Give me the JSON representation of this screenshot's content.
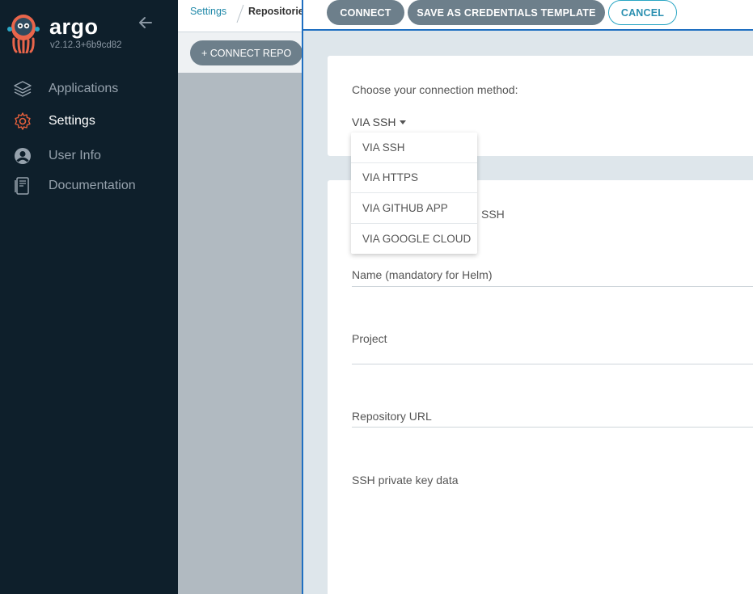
{
  "sidebar": {
    "brand": "argo",
    "version": "v2.12.3+6b9cd82",
    "items": [
      {
        "label": "Applications",
        "icon": "layers-icon"
      },
      {
        "label": "Settings",
        "icon": "gear-icon"
      },
      {
        "label": "User Info",
        "icon": "user-icon"
      },
      {
        "label": "Documentation",
        "icon": "book-icon"
      }
    ]
  },
  "breadcrumb": {
    "parent": "Settings",
    "current": "Repositories"
  },
  "toolbar": {
    "connect_repo": "+ CONNECT REPO"
  },
  "panel": {
    "actions": {
      "connect": "CONNECT",
      "save_template": "SAVE AS CREDENTIALS TEMPLATE",
      "cancel": "CANCEL"
    },
    "method_label": "Choose your connection method:",
    "method_selected": "VIA SSH",
    "dropdown_options": [
      "VIA SSH",
      "VIA HTTPS",
      "VIA GITHUB APP",
      "VIA GOOGLE CLOUD"
    ],
    "section_partial_title": "SSH",
    "fields": {
      "name": "Name (mandatory for Helm)",
      "project": "Project",
      "repo_url": "Repository URL",
      "ssh_key": "SSH private key data"
    }
  },
  "colors": {
    "sidebar_bg": "#0e1f2b",
    "accent": "#1f6fc1",
    "button": "#6d7f8b",
    "settings_icon": "#e8603c"
  }
}
